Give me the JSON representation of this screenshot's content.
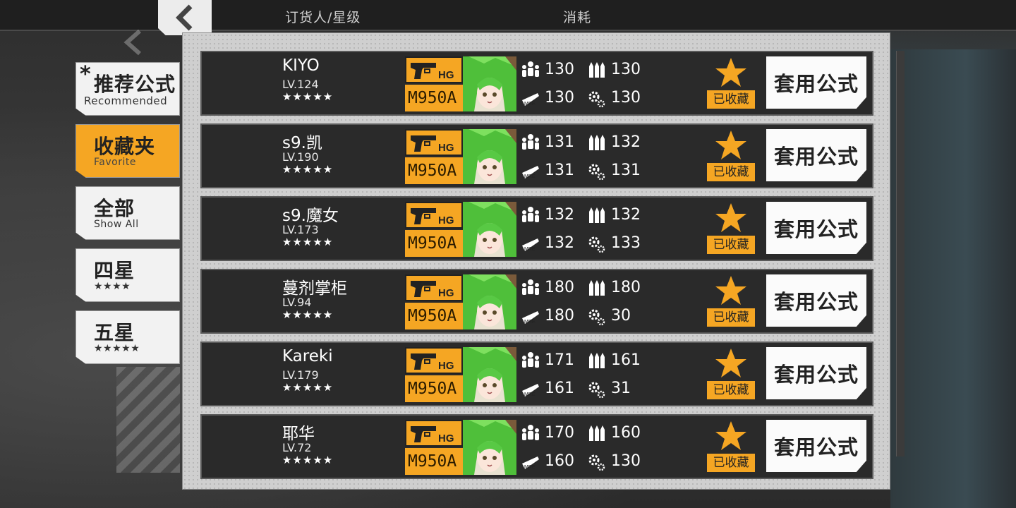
{
  "header": {
    "col_commissioner": "订货人/星级",
    "col_cost": "消耗"
  },
  "sidebar": {
    "items": [
      {
        "label": "推荐公式",
        "sub": "Recommended",
        "mark": "*",
        "active": false
      },
      {
        "label": "收藏夹",
        "sub": "Favorite",
        "active": true
      },
      {
        "label": "全部",
        "sub": "Show All",
        "active": false
      },
      {
        "label": "四星",
        "sub": "★★★★",
        "active": false
      },
      {
        "label": "五星",
        "sub": "★★★★★",
        "active": false
      }
    ]
  },
  "rows": [
    {
      "name": "KIYO",
      "level": "LV.124",
      "stars": "★★★★★",
      "doll_class": "HG",
      "doll_name": "M950A",
      "manpower": "130",
      "ammo": "130",
      "rations": "130",
      "parts": "130",
      "fav_label": "已收藏",
      "apply_label": "套用公式"
    },
    {
      "name": "s9.凯",
      "level": "LV.190",
      "stars": "★★★★★",
      "doll_class": "HG",
      "doll_name": "M950A",
      "manpower": "131",
      "ammo": "132",
      "rations": "131",
      "parts": "131",
      "fav_label": "已收藏",
      "apply_label": "套用公式"
    },
    {
      "name": "s9.魔女",
      "level": "LV.173",
      "stars": "★★★★★",
      "doll_class": "HG",
      "doll_name": "M950A",
      "manpower": "132",
      "ammo": "132",
      "rations": "132",
      "parts": "133",
      "fav_label": "已收藏",
      "apply_label": "套用公式"
    },
    {
      "name": "蔓剂掌柜",
      "level": "LV.94",
      "stars": "★★★★★",
      "doll_class": "HG",
      "doll_name": "M950A",
      "manpower": "180",
      "ammo": "180",
      "rations": "180",
      "parts": "30",
      "fav_label": "已收藏",
      "apply_label": "套用公式"
    },
    {
      "name": "Kareki",
      "level": "LV.179",
      "stars": "★★★★★",
      "doll_class": "HG",
      "doll_name": "M950A",
      "manpower": "171",
      "ammo": "161",
      "rations": "161",
      "parts": "31",
      "fav_label": "已收藏",
      "apply_label": "套用公式"
    },
    {
      "name": "耶华",
      "level": "LV.72",
      "stars": "★★★★★",
      "doll_class": "HG",
      "doll_name": "M950A",
      "manpower": "170",
      "ammo": "160",
      "rations": "160",
      "parts": "130",
      "fav_label": "已收藏",
      "apply_label": "套用公式"
    }
  ],
  "icons": {
    "back": "chevron-left-icon",
    "manpower": "manpower-icon",
    "ammo": "ammo-icon",
    "rations": "rations-icon",
    "parts": "parts-icon",
    "favorite": "star-icon",
    "gun": "handgun-icon"
  },
  "colors": {
    "accent": "#f5a623",
    "row_bg": "#2a2a2a",
    "panel_bg": "#cfcfcf"
  }
}
